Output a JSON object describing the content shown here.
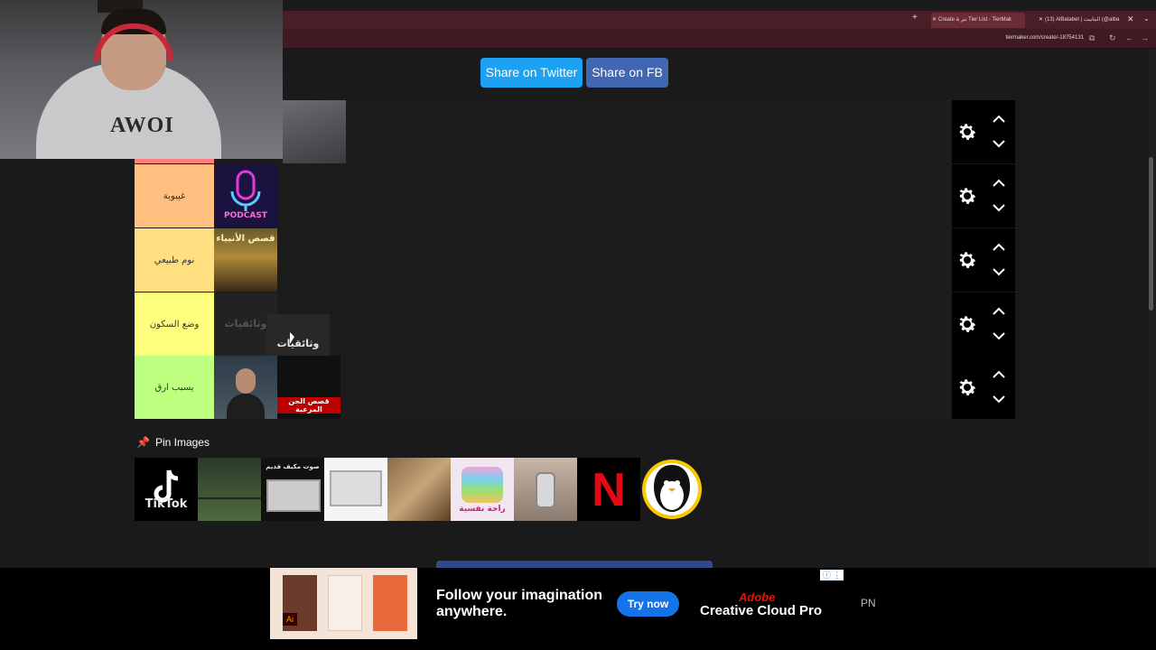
{
  "browser": {
    "tabs": [
      {
        "label": "Create a تير Tier List - TierMak",
        "active": true
      },
      {
        "label": "(13) AlBatabet | البتابيت (@alba",
        "active": false
      }
    ],
    "new_tab_icon": "plus-icon",
    "url": "tiermaker.com/create/-18754131"
  },
  "share": {
    "twitter_label": "Share on Twitter",
    "fb_label": "Share on FB",
    "twitter_color": "#1da1f2",
    "fb_color": "#4167b2"
  },
  "tiers": [
    {
      "label": "",
      "color": "#ff7f7f",
      "items": [
        {
          "type": "face-photo",
          "text": ""
        }
      ]
    },
    {
      "label": "غيبوبة",
      "color": "#ffbf7f",
      "items": [
        {
          "type": "podcast",
          "text": "PODCAST"
        }
      ]
    },
    {
      "label": "نوم طبيعي",
      "color": "#ffdf7f",
      "items": [
        {
          "type": "prophets",
          "text": "قصص الأنبياء"
        }
      ]
    },
    {
      "label": "وضع السكون",
      "color": "#ffff7f",
      "items": [
        {
          "type": "dark",
          "text": "وثائقيات"
        },
        {
          "type": "wathaq",
          "text": "وثائقيات"
        }
      ]
    },
    {
      "label": "يسبب ارق",
      "color": "#bfff7f",
      "items": [
        {
          "type": "man",
          "text": ""
        },
        {
          "type": "jinn",
          "text": "قصص الجن المرعبة"
        }
      ]
    }
  ],
  "pin_section": {
    "title": "Pin Images",
    "images": [
      {
        "name": "tiktok",
        "text": "TikTok"
      },
      {
        "name": "rain-window",
        "text": ""
      },
      {
        "name": "old-ac",
        "text": "صوت مكيف قديم"
      },
      {
        "name": "window-ac",
        "text": ""
      },
      {
        "name": "quran-book",
        "text": ""
      },
      {
        "name": "color-cubes",
        "text": "راحة نفسية"
      },
      {
        "name": "microphone",
        "text": ""
      },
      {
        "name": "netflix",
        "text": "N"
      },
      {
        "name": "penguin",
        "text": ""
      }
    ]
  },
  "ad": {
    "headline": "Follow your imagination anywhere.",
    "cta": "Try now",
    "brand_top": "Adobe",
    "brand_bottom": "Creative Cloud Pro",
    "tail": "PN"
  },
  "webcam": {
    "shirt_text": "AWOI"
  }
}
